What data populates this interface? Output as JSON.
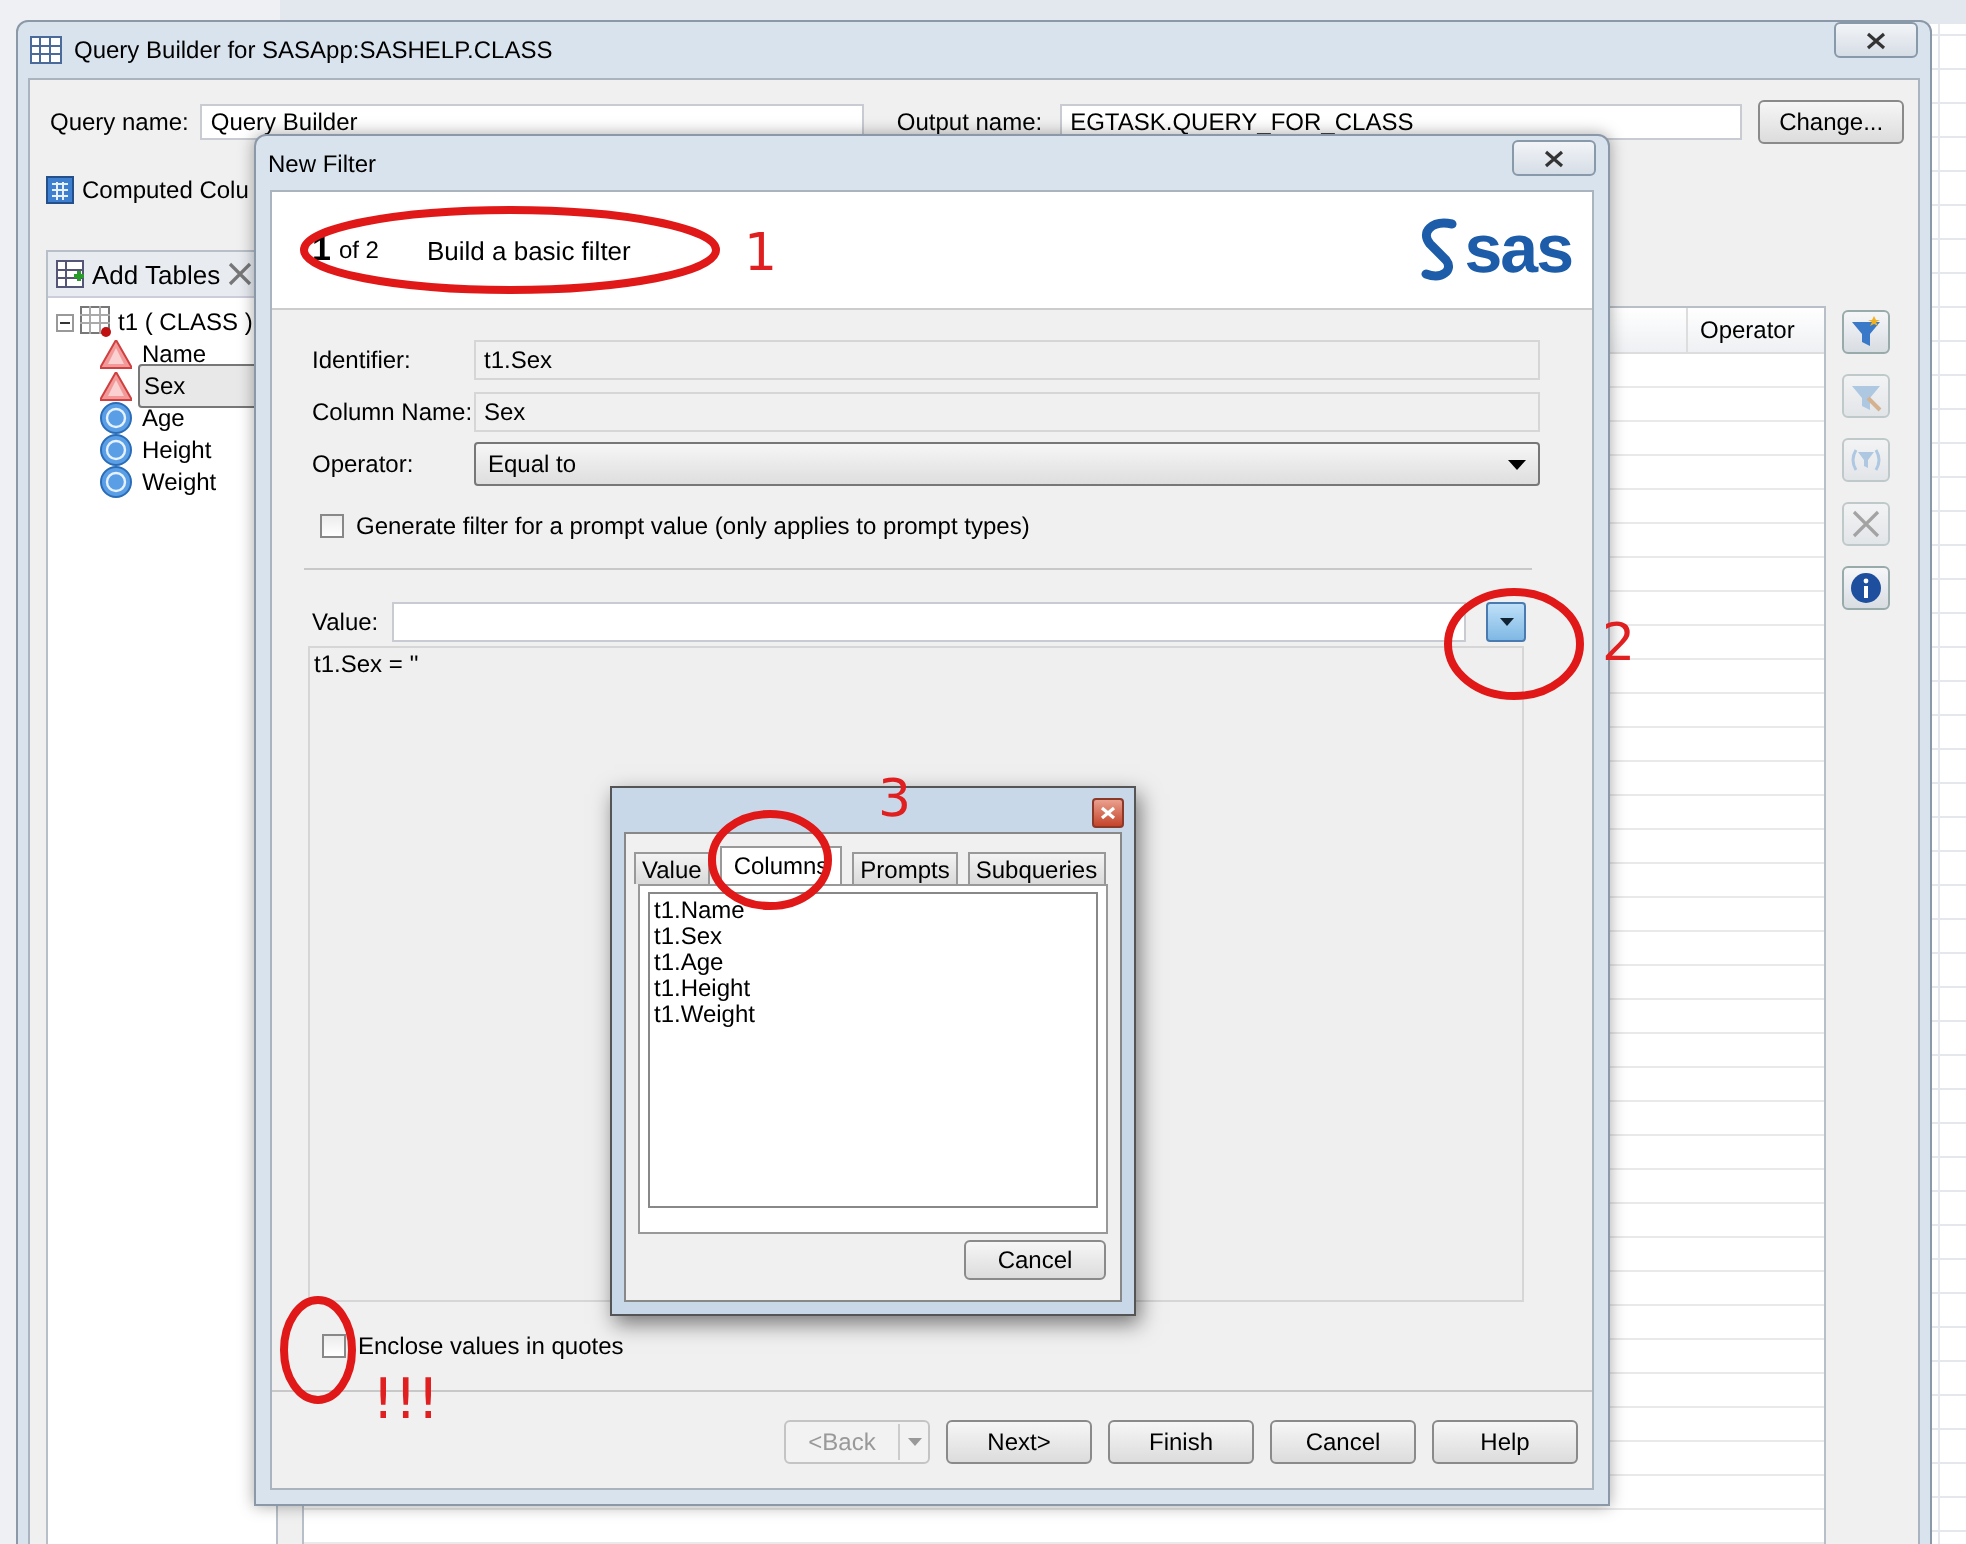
{
  "window": {
    "title": "Query Builder for SASApp:SASHELP.CLASS"
  },
  "query_name": {
    "label": "Query name:",
    "value": "Query Builder"
  },
  "output_name": {
    "label": "Output name:",
    "value": "EGTASK.QUERY_FOR_CLASS"
  },
  "change_button": "Change...",
  "computed_columns": "Computed Colu",
  "add_tables": "Add Tables",
  "tree": {
    "label": "t1 ( CLASS )",
    "expanded": true,
    "children": [
      {
        "label": "Name",
        "kind": "char",
        "selected": false
      },
      {
        "label": "Sex",
        "kind": "char",
        "selected": true
      },
      {
        "label": "Age",
        "kind": "num",
        "selected": false
      },
      {
        "label": "Height",
        "kind": "num",
        "selected": false
      },
      {
        "label": "Weight",
        "kind": "num",
        "selected": false
      }
    ]
  },
  "grid": {
    "columns": [
      {
        "label": "Operator"
      }
    ]
  },
  "side_buttons": [
    {
      "kind": "new-filter",
      "disabled": false
    },
    {
      "kind": "edit-filter",
      "disabled": true
    },
    {
      "kind": "group",
      "disabled": true
    },
    {
      "kind": "delete",
      "disabled": true
    },
    {
      "kind": "info",
      "disabled": false
    }
  ],
  "new_filter": {
    "title": "New Filter",
    "step": "1",
    "of": "of 2",
    "heading": "Build a basic filter",
    "logo": "sas",
    "identifier": {
      "label": "Identifier:",
      "value": "t1.Sex"
    },
    "column_name": {
      "label": "Column Name:",
      "value": "Sex"
    },
    "operator": {
      "label": "Operator:",
      "value": "Equal to"
    },
    "prompt_checkbox": {
      "label": "Generate filter for a prompt value (only applies to prompt types)",
      "checked": false
    },
    "value_field": {
      "label": "Value:"
    },
    "expression": "t1.Sex = ''",
    "enclose_checkbox": {
      "label": "Enclose values in quotes",
      "checked": false
    },
    "buttons": [
      {
        "label": "<Back",
        "kind": "split",
        "disabled": true
      },
      {
        "label": "Next>",
        "kind": "plain",
        "disabled": false
      },
      {
        "label": "Finish",
        "kind": "plain",
        "disabled": false
      },
      {
        "label": "Cancel",
        "kind": "plain",
        "disabled": false
      },
      {
        "label": "Help",
        "kind": "plain",
        "disabled": false
      }
    ]
  },
  "value_picker": {
    "tabs": [
      {
        "label": "Value",
        "selected": false
      },
      {
        "label": "Columns",
        "selected": true
      },
      {
        "label": "Prompts",
        "selected": false
      },
      {
        "label": "Subqueries",
        "selected": false
      }
    ],
    "items": [
      "t1.Name",
      "t1.Sex",
      "t1.Age",
      "t1.Height",
      "t1.Weight"
    ],
    "cancel": "Cancel"
  },
  "annotations": [
    {
      "text": "1"
    },
    {
      "text": "2"
    },
    {
      "text": "3"
    },
    {
      "text": "!!!"
    }
  ]
}
